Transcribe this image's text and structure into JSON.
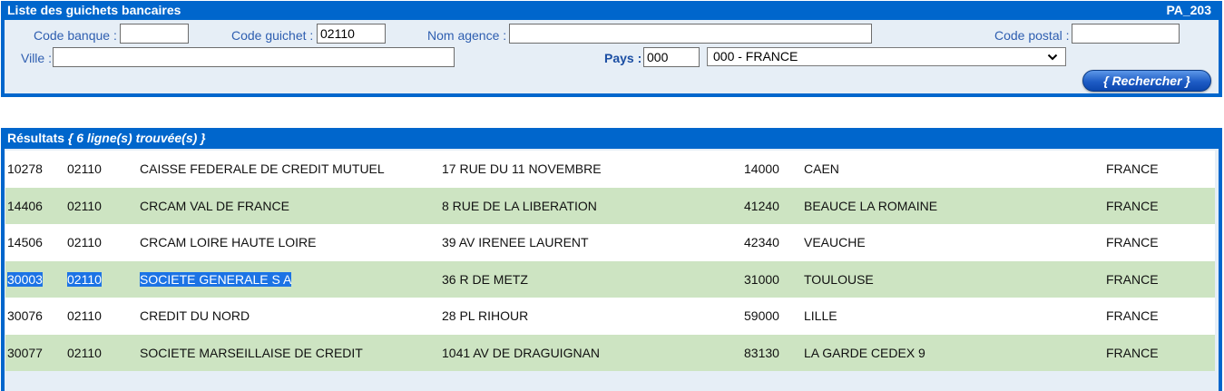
{
  "search": {
    "title": "Liste des guichets bancaires",
    "screen_code": "PA_203",
    "code_banque_label": "Code banque :",
    "code_banque_value": "",
    "code_guichet_label": "Code guichet :",
    "code_guichet_value": "02110",
    "nom_agence_label": "Nom agence :",
    "nom_agence_value": "",
    "code_postal_label": "Code postal :",
    "code_postal_value": "",
    "ville_label": "Ville :",
    "ville_value": "",
    "pays_label": "Pays :",
    "pays_value": "000",
    "pays_select_value": "000 - FRANCE",
    "search_button": "{ Rechercher }"
  },
  "results": {
    "title": "Résultats",
    "count_text": "{ 6 ligne(s) trouvée(s) }",
    "rows": [
      {
        "banque": "10278",
        "guichet": "02110",
        "nom": "CAISSE FEDERALE DE CREDIT MUTUEL",
        "adresse": "17 RUE DU 11 NOVEMBRE",
        "cp": "14000",
        "ville": "CAEN",
        "pays": "FRANCE"
      },
      {
        "banque": "14406",
        "guichet": "02110",
        "nom": "CRCAM VAL DE FRANCE",
        "adresse": "8 RUE DE LA LIBERATION",
        "cp": "41240",
        "ville": "BEAUCE LA ROMAINE",
        "pays": "FRANCE"
      },
      {
        "banque": "14506",
        "guichet": "02110",
        "nom": "CRCAM LOIRE HAUTE LOIRE",
        "adresse": "39 AV IRENEE LAURENT",
        "cp": "42340",
        "ville": "VEAUCHE",
        "pays": "FRANCE"
      },
      {
        "banque": "30003",
        "guichet": "02110",
        "nom": "SOCIETE GENERALE S A",
        "adresse": "36 R DE METZ",
        "cp": "31000",
        "ville": "TOULOUSE",
        "pays": "FRANCE"
      },
      {
        "banque": "30076",
        "guichet": "02110",
        "nom": "CREDIT DU NORD",
        "adresse": "28 PL RIHOUR",
        "cp": "59000",
        "ville": "LILLE",
        "pays": "FRANCE"
      },
      {
        "banque": "30077",
        "guichet": "02110",
        "nom": "SOCIETE MARSEILLAISE DE CREDIT",
        "adresse": "1041 AV DE DRAGUIGNAN",
        "cp": "83130",
        "ville": "LA GARDE CEDEX 9",
        "pays": "FRANCE"
      }
    ]
  }
}
